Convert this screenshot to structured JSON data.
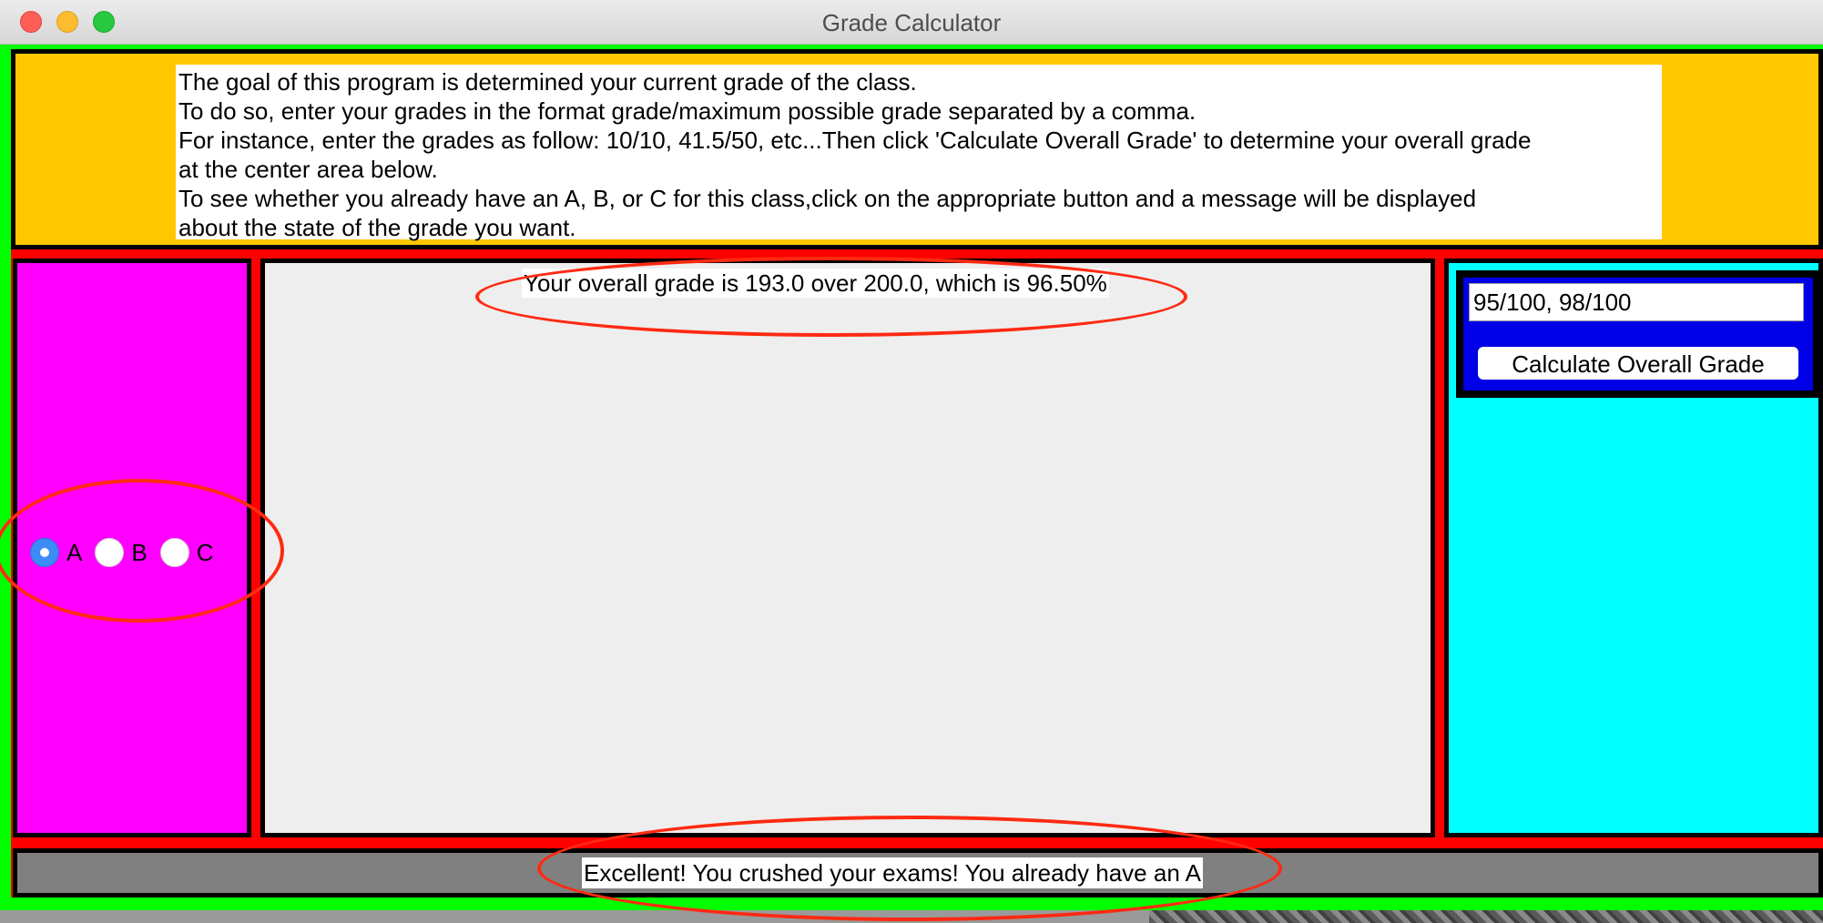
{
  "window": {
    "title": "Grade Calculator"
  },
  "instructions": {
    "lines": [
      "The goal of this program is determined your current grade of the class.",
      "To do so, enter your grades in the format grade/maximum possible grade separated by a comma.",
      "For instance, enter the grades as follow: 10/10, 41.5/50, etc...Then click 'Calculate Overall Grade' to determine your overall grade",
      "at the center area below.",
      "To see whether you already have an A, B, or C for this class,click on the appropriate button and a message will be displayed",
      "about the state of the grade you want."
    ]
  },
  "grade_options": {
    "selected": "A",
    "items": [
      {
        "label": "A",
        "selected": true
      },
      {
        "label": "B",
        "selected": false
      },
      {
        "label": "C",
        "selected": false
      }
    ]
  },
  "center": {
    "result": "Your overall grade is 193.0 over 200.0, which is 96.50%"
  },
  "input_panel": {
    "grades_value": "95/100, 98/100",
    "calculate_label": "Calculate Overall Grade"
  },
  "status": {
    "message": "Excellent! You crushed your exams! You already have an A"
  },
  "colors": {
    "window_bg": "#00ff00",
    "top_panel": "#ffc700",
    "left_panel": "#ff00ff",
    "center_panel": "#eeeeee",
    "right_panel": "#00ffff",
    "input_box": "#0000e6",
    "bottom_panel": "#808080",
    "separator": "#ff0000",
    "annotation": "#ff2a12",
    "radio_selected": "#3d8bf7"
  }
}
